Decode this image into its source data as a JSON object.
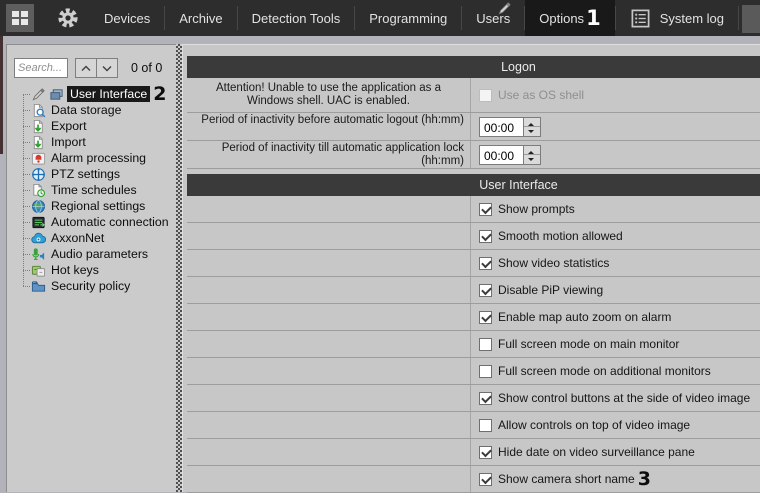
{
  "topbar": {
    "menu": [
      {
        "label": "Devices"
      },
      {
        "label": "Archive"
      },
      {
        "label": "Detection Tools"
      },
      {
        "label": "Programming"
      },
      {
        "label": "Users"
      },
      {
        "label": "Options",
        "active": true,
        "callout": "1"
      },
      {
        "label": "System log",
        "icon": "system-log"
      }
    ]
  },
  "sidebar": {
    "search": {
      "placeholder": "Search..."
    },
    "match_counter": "0 of 0",
    "tree": [
      {
        "label": "User Interface",
        "icons": [
          "pencil",
          "ui-screens"
        ],
        "selected": true,
        "callout": "2"
      },
      {
        "label": "Data storage",
        "icons": [
          "data-storage"
        ]
      },
      {
        "label": "Export",
        "icons": [
          "export"
        ]
      },
      {
        "label": "Import",
        "icons": [
          "import"
        ]
      },
      {
        "label": "Alarm processing",
        "icons": [
          "alarm"
        ]
      },
      {
        "label": "PTZ settings",
        "icons": [
          "ptz"
        ]
      },
      {
        "label": "Time schedules",
        "icons": [
          "schedule"
        ]
      },
      {
        "label": "Regional settings",
        "icons": [
          "globe"
        ]
      },
      {
        "label": "Automatic connection",
        "icons": [
          "connection"
        ]
      },
      {
        "label": "AxxonNet",
        "icons": [
          "cloud"
        ]
      },
      {
        "label": "Audio parameters",
        "icons": [
          "audio"
        ]
      },
      {
        "label": "Hot keys",
        "icons": [
          "hotkeys"
        ]
      },
      {
        "label": "Security policy",
        "icons": [
          "security"
        ]
      }
    ]
  },
  "logon": {
    "header": "Logon",
    "attention": "Attention! Unable to use the application as a Windows shell. UAC is enabled.",
    "os_shell": {
      "label": "Use as OS shell",
      "checked": false,
      "disabled": true
    },
    "logout": {
      "label": "Period of inactivity before automatic logout (hh:mm)",
      "value": "00:00"
    },
    "lock": {
      "label": "Period of inactivity till automatic application lock (hh:mm)",
      "value": "00:00"
    }
  },
  "user_interface": {
    "header": "User Interface",
    "options": [
      {
        "label": "Show prompts",
        "checked": true
      },
      {
        "label": "Smooth motion allowed",
        "checked": true
      },
      {
        "label": "Show video statistics",
        "checked": true
      },
      {
        "label": "Disable PiP viewing",
        "checked": true
      },
      {
        "label": "Enable map auto zoom on alarm",
        "checked": true
      },
      {
        "label": "Full screen mode on main monitor",
        "checked": false
      },
      {
        "label": "Full screen mode on additional monitors",
        "checked": false
      },
      {
        "label": "Show control buttons at the side of video image",
        "checked": true
      },
      {
        "label": "Allow controls on top of video image",
        "checked": false
      },
      {
        "label": "Hide date on video surveillance pane",
        "checked": true
      },
      {
        "label": "Show camera short name",
        "checked": true,
        "callout": "3"
      }
    ]
  },
  "colors": {
    "topbar_bg": "#2d2d2d",
    "active_tab_bg": "#191919",
    "selection_bg": "#191919",
    "section_header_bg": "#3a3a3a",
    "panel_bg": "#c7c7c7",
    "window_frame": "#b2b2ba",
    "icon_green": "#2f9e2f",
    "icon_blue": "#2f7fc4",
    "icon_red": "#d43a2f"
  }
}
